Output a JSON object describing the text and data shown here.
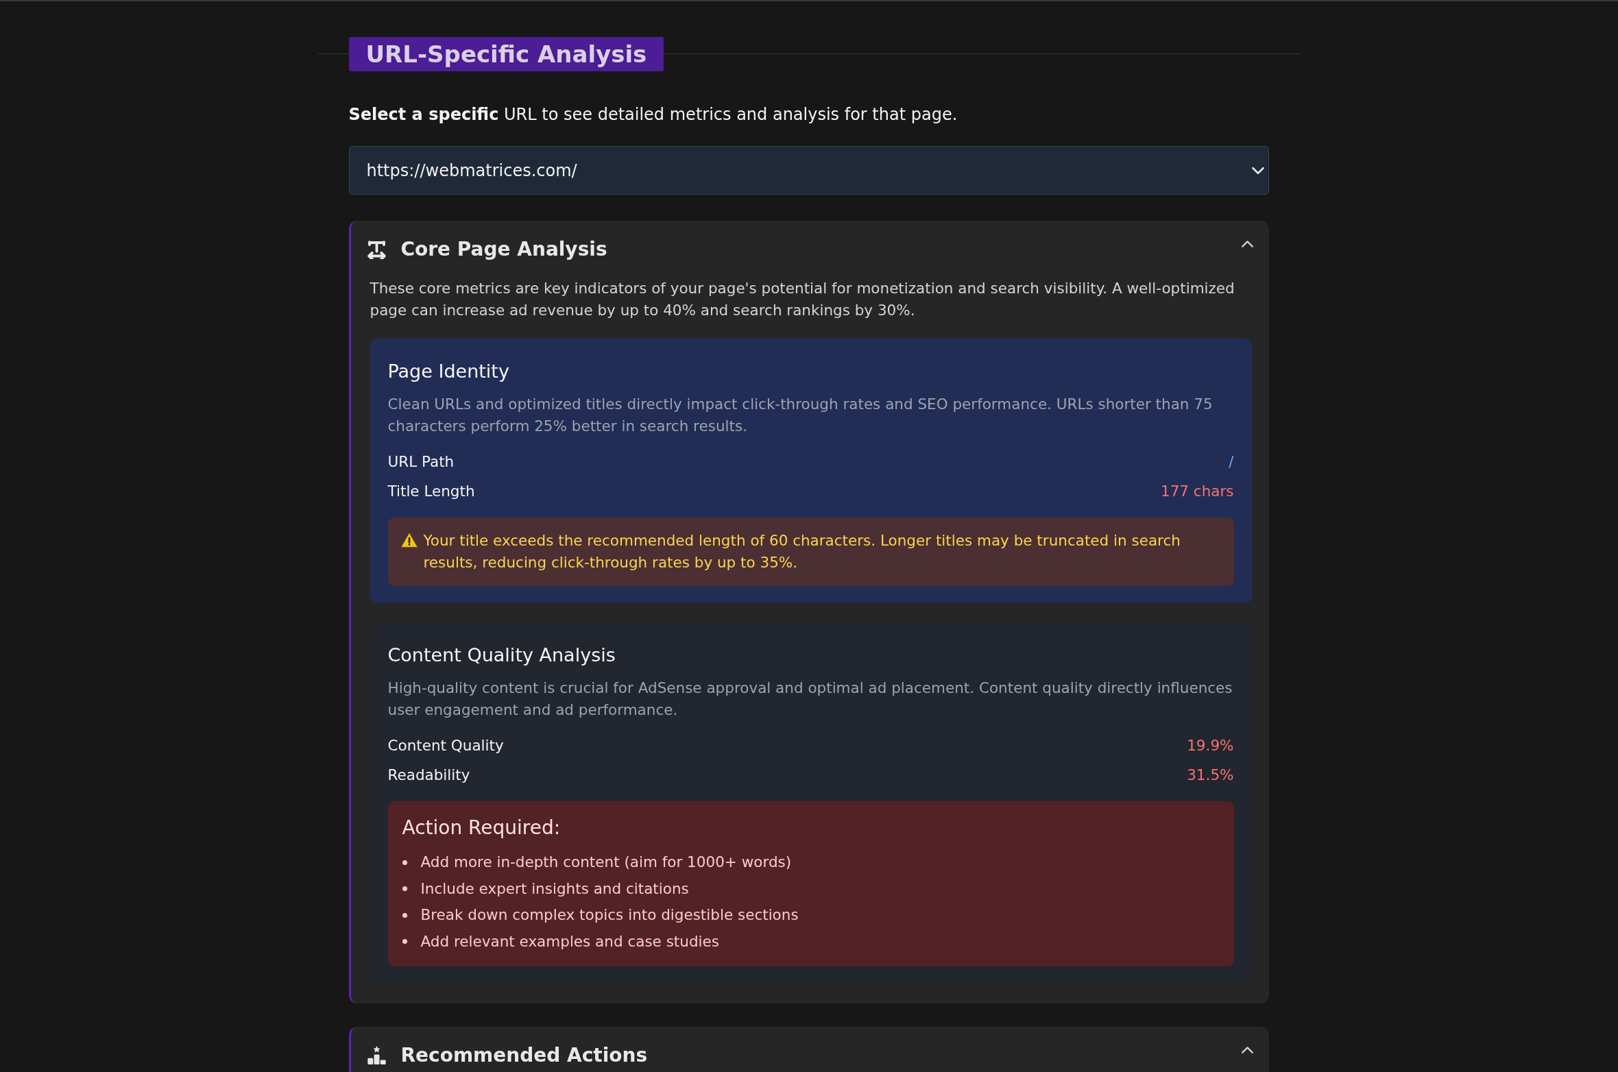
{
  "section": {
    "title": "URL-Specific Analysis",
    "intro": "**Select a specific** URL to see detailed metrics and analysis for that page."
  },
  "url_select": {
    "value": "https://webmatrices.com/"
  },
  "panels": [
    {
      "title": "Core Page Analysis",
      "expanded": true,
      "description": "These core metrics are key indicators of your page's potential for monetization and search visibility. A well-optimized page can increase ad revenue by up to 40% and search rankings by 30%.",
      "sections": [
        {
          "kind": "identity",
          "title": "Page Identity",
          "description": "Clean URLs and optimized titles directly impact click-through rates and SEO performance. URLs shorter than 75 characters perform 25% better in search results.",
          "metrics": [
            {
              "label": "URL Path",
              "value": "/",
              "color": "#60a5fa"
            },
            {
              "label": "Title Length",
              "value": "177 chars",
              "color": "#f87171"
            }
          ],
          "alert": {
            "kind": "warning",
            "text": "Your title exceeds the recommended length of 60 characters. Longer titles may be truncated in search results, reducing click-through rates by up to 35%."
          }
        },
        {
          "kind": "content",
          "title": "Content Quality Analysis",
          "description": "High-quality content is crucial for AdSense approval and optimal ad placement. Content quality directly influences user engagement and ad performance.",
          "metrics": [
            {
              "label": "Content Quality",
              "value": "19.9%",
              "color": "#f87171"
            },
            {
              "label": "Readability",
              "value": "31.5%",
              "color": "#f87171"
            }
          ],
          "alert": {
            "kind": "action",
            "title": "Action Required:",
            "items": [
              "Add more in-depth content (aim for 1000+ words)",
              "Include expert insights and citations",
              "Break down complex topics into digestible sections",
              "Add relevant examples and case studies"
            ]
          }
        }
      ]
    },
    {
      "title": "Recommended Actions",
      "expanded": true
    }
  ]
}
